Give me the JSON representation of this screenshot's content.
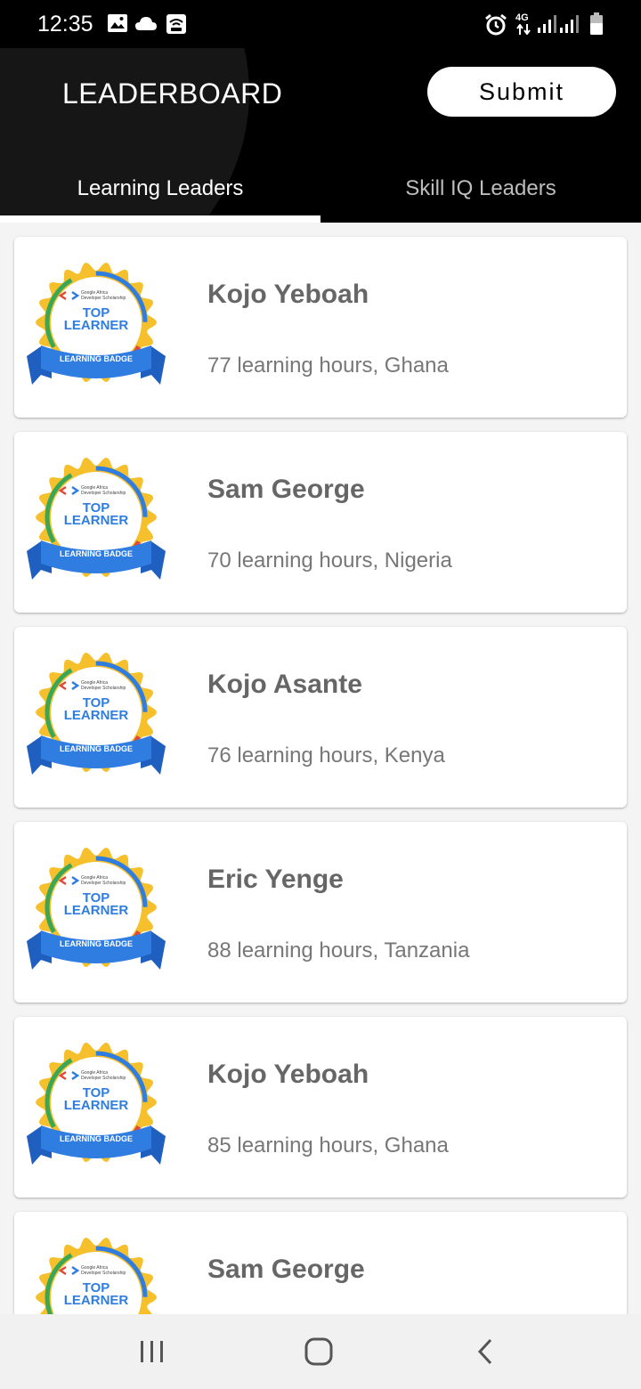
{
  "status_bar": {
    "time": "12:35",
    "left_icons": [
      "image-icon",
      "cloud-icon",
      "wifi-call-icon"
    ],
    "right_icons": [
      "alarm-icon",
      "network-4g-icon",
      "signal-icon",
      "signal-icon",
      "battery-icon"
    ],
    "network_label": "4G"
  },
  "app_bar": {
    "title": "LEADERBOARD",
    "submit_label": "Submit"
  },
  "tabs": [
    {
      "label": "Learning Leaders",
      "selected": true
    },
    {
      "label": "Skill IQ Leaders",
      "selected": false
    }
  ],
  "badge": {
    "header": "Google Africa Developer Scholarship",
    "line1": "TOP",
    "line2": "LEARNER",
    "ribbon": "LEARNING BADGE"
  },
  "leaders": [
    {
      "name": "Kojo Yeboah",
      "detail": "77 learning hours, Ghana"
    },
    {
      "name": "Sam George",
      "detail": "70 learning hours, Nigeria"
    },
    {
      "name": "Kojo Asante",
      "detail": "76 learning hours, Kenya"
    },
    {
      "name": "Eric Yenge",
      "detail": "88 learning hours, Tanzania"
    },
    {
      "name": "Kojo Yeboah",
      "detail": "85 learning hours, Ghana"
    },
    {
      "name": "Sam George",
      "detail": ""
    }
  ],
  "nav_bar": {
    "buttons": [
      "recents-icon",
      "home-icon",
      "back-icon"
    ]
  },
  "colors": {
    "app_bar": "#000000",
    "tab_selected": "#ffffff",
    "tab_unselected": "#bdbdbd",
    "badge_gold": "#f6c02c",
    "badge_blue": "#2f7de1",
    "badge_red": "#e0493b",
    "badge_green": "#3aa757"
  }
}
